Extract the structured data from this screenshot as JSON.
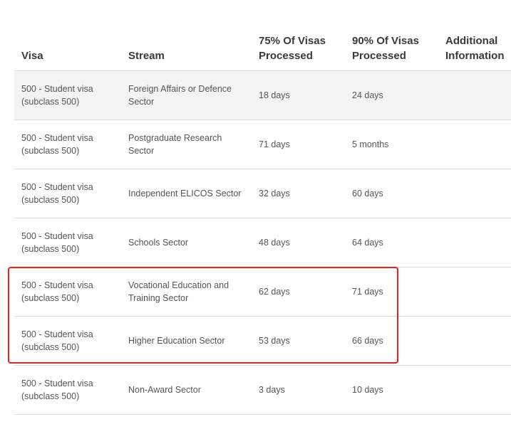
{
  "table": {
    "headers": {
      "visa": "Visa",
      "stream": "Stream",
      "p75": "75% Of Visas Processed",
      "p90": "90% Of Visas Processed",
      "info": "Additional Information"
    },
    "rows": [
      {
        "visa": "500 - Student visa (subclass 500)",
        "stream": "Foreign Affairs or Defence Sector",
        "p75": "18 days",
        "p90": "24 days",
        "info": ""
      },
      {
        "visa": "500 - Student visa (subclass 500)",
        "stream": "Postgraduate Research Sector",
        "p75": "71 days",
        "p90": "5 months",
        "info": ""
      },
      {
        "visa": "500 - Student visa (subclass 500)",
        "stream": "Independent ELICOS Sector",
        "p75": "32 days",
        "p90": "60 days",
        "info": ""
      },
      {
        "visa": "500 - Student visa (subclass 500)",
        "stream": "Schools Sector",
        "p75": "48 days",
        "p90": "64 days",
        "info": ""
      },
      {
        "visa": "500 - Student visa (subclass 500)",
        "stream": "Vocational Education and Training Sector",
        "p75": "62 days",
        "p90": "71 days",
        "info": ""
      },
      {
        "visa": "500 - Student visa (subclass 500)",
        "stream": "Higher Education Sector",
        "p75": "53 days",
        "p90": "66 days",
        "info": ""
      },
      {
        "visa": "500 - Student visa (subclass 500)",
        "stream": "Non-Award Sector",
        "p75": "3 days",
        "p90": "10 days",
        "info": ""
      }
    ]
  },
  "colors": {
    "header_text": "#3a3a3a",
    "cell_text": "#555555",
    "row_divider": "#dcdcdc",
    "first_row_bg": "#f3f3f3",
    "highlight_border": "#e8241a"
  }
}
